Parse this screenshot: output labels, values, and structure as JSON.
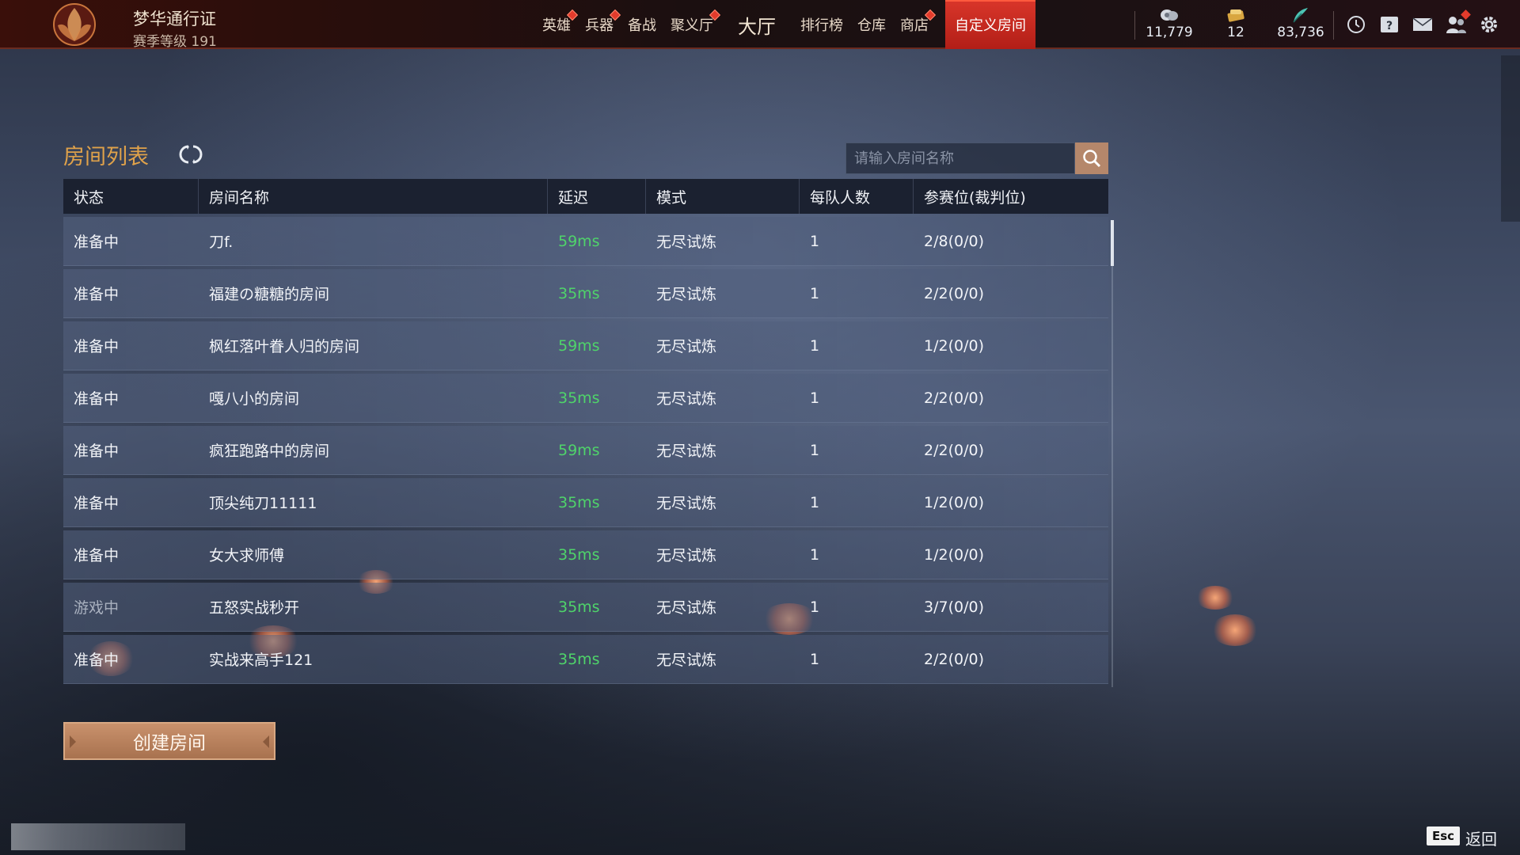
{
  "header": {
    "pass_title": "梦华通行证",
    "pass_level": "赛季等级 191",
    "nav": [
      {
        "label": "英雄",
        "dot": true
      },
      {
        "label": "兵器",
        "dot": true
      },
      {
        "label": "备战",
        "dot": false
      },
      {
        "label": "聚义厅",
        "dot": true
      },
      {
        "label": "大厅",
        "dot": false,
        "big": true
      },
      {
        "label": "排行榜",
        "dot": false
      },
      {
        "label": "仓库",
        "dot": false
      },
      {
        "label": "商店",
        "dot": true
      },
      {
        "label": "自定义房间",
        "dot": false,
        "active": true
      }
    ],
    "currencies": [
      {
        "icon": "coin-icon",
        "value": "11,779"
      },
      {
        "icon": "ticket-icon",
        "value": "12"
      },
      {
        "icon": "feather-icon",
        "value": "83,736"
      }
    ],
    "system_icons": [
      "clock-icon",
      "help-book-icon",
      "mail-icon",
      "friends-icon",
      "settings-icon"
    ]
  },
  "room_list": {
    "title": "房间列表",
    "search_placeholder": "请输入房间名称",
    "columns": [
      "状态",
      "房间名称",
      "延迟",
      "模式",
      "每队人数",
      "参赛位(裁判位)"
    ],
    "rows": [
      {
        "status": "准备中",
        "name": "刀f.",
        "latency": "59ms",
        "mode": "无尽试炼",
        "per_team": "1",
        "slots": "2/8(0/0)"
      },
      {
        "status": "准备中",
        "name": "福建の糖糖的房间",
        "latency": "35ms",
        "mode": "无尽试炼",
        "per_team": "1",
        "slots": "2/2(0/0)"
      },
      {
        "status": "准备中",
        "name": "枫红落叶眷人归的房间",
        "latency": "59ms",
        "mode": "无尽试炼",
        "per_team": "1",
        "slots": "1/2(0/0)"
      },
      {
        "status": "准备中",
        "name": "嘎八小的房间",
        "latency": "35ms",
        "mode": "无尽试炼",
        "per_team": "1",
        "slots": "2/2(0/0)"
      },
      {
        "status": "准备中",
        "name": "疯狂跑路中的房间",
        "latency": "59ms",
        "mode": "无尽试炼",
        "per_team": "1",
        "slots": "2/2(0/0)"
      },
      {
        "status": "准备中",
        "name": "顶尖纯刀11111",
        "latency": "35ms",
        "mode": "无尽试炼",
        "per_team": "1",
        "slots": "1/2(0/0)"
      },
      {
        "status": "准备中",
        "name": "女大求师傅",
        "latency": "35ms",
        "mode": "无尽试炼",
        "per_team": "1",
        "slots": "1/2(0/0)"
      },
      {
        "status": "游戏中",
        "name": "五怒实战秒开",
        "latency": "35ms",
        "mode": "无尽试炼",
        "per_team": "1",
        "slots": "3/7(0/0)"
      },
      {
        "status": "准备中",
        "name": "实战来高手121",
        "latency": "35ms",
        "mode": "无尽试炼",
        "per_team": "1",
        "slots": "2/2(0/0)"
      }
    ]
  },
  "actions": {
    "create_room": "创建房间",
    "esc_key": "Esc",
    "back_label": "返回"
  },
  "colors": {
    "accent_title": "#e0a24a",
    "latency_good": "#4fd46a",
    "active_tab": "#c9281e",
    "create_button": "#b98060"
  }
}
